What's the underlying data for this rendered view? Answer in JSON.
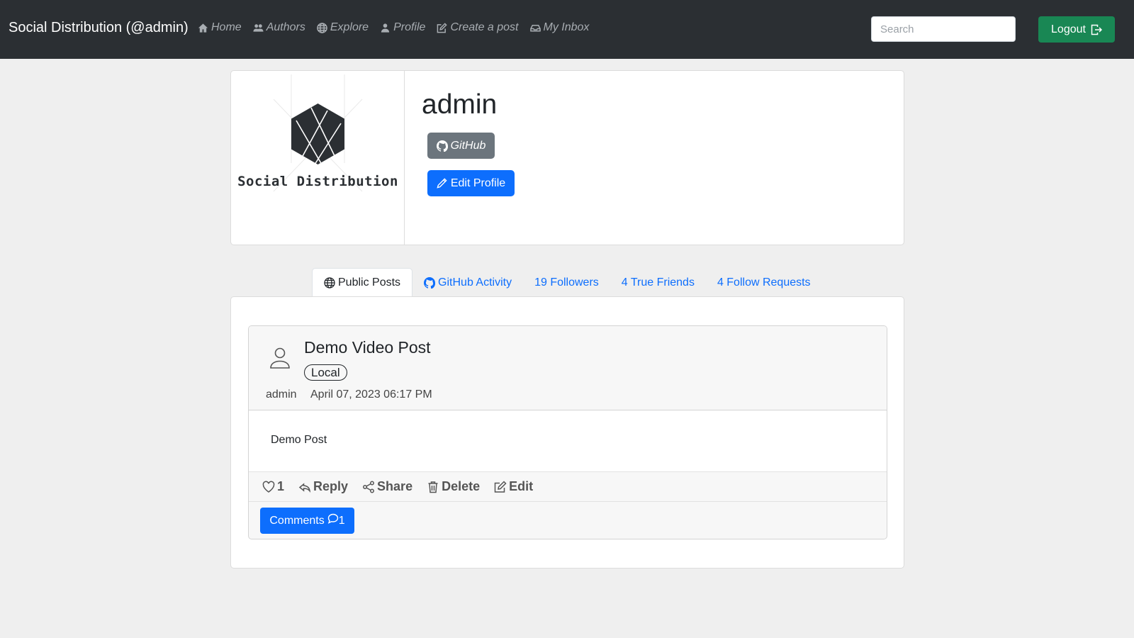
{
  "nav": {
    "brand": "Social Distribution (@admin)",
    "items": [
      {
        "label": "Home",
        "icon": "house-icon"
      },
      {
        "label": "Authors",
        "icon": "people-icon"
      },
      {
        "label": "Explore",
        "icon": "globe-icon"
      },
      {
        "label": "Profile",
        "icon": "person-icon"
      },
      {
        "label": "Create a post",
        "icon": "pencil-square-icon"
      },
      {
        "label": "My Inbox",
        "icon": "inbox-icon"
      }
    ],
    "search_placeholder": "Search",
    "search_value": "",
    "logout_label": "Logout"
  },
  "profile": {
    "logo_text": "Social Distribution",
    "name": "admin",
    "github_label": "GitHub",
    "edit_label": "Edit Profile"
  },
  "tabs": [
    {
      "label": "Public Posts",
      "active": true,
      "icon": "globe-icon"
    },
    {
      "label": "GitHub Activity",
      "active": false,
      "icon": "github-icon"
    },
    {
      "label": "19 Followers",
      "active": false
    },
    {
      "label": "4 True Friends",
      "active": false
    },
    {
      "label": "4 Follow Requests",
      "active": false
    }
  ],
  "post": {
    "title": "Demo Video Post",
    "badge": "Local",
    "author": "admin",
    "date": "April 07, 2023 06:17 PM",
    "body": "Demo Post",
    "likes": "1",
    "reply_label": "Reply",
    "share_label": "Share",
    "delete_label": "Delete",
    "edit_label": "Edit",
    "comments_label": "Comments",
    "comments_count": "1"
  },
  "colors": {
    "navbar": "#2b2f33",
    "primary": "#0d6efd",
    "success": "#198754",
    "secondary": "#6c757d",
    "page_bg": "#efefef"
  }
}
